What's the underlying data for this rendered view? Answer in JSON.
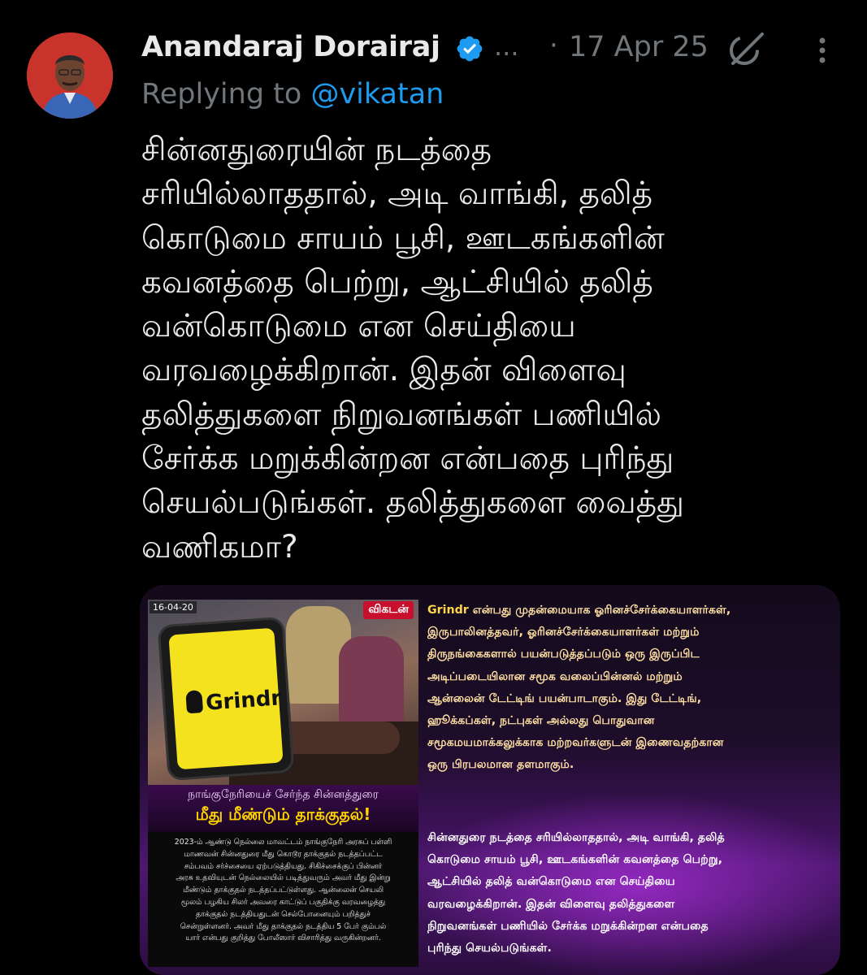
{
  "tweet": {
    "author_name": "Anandaraj Dorairaj",
    "more_name": "...",
    "dot": "·",
    "date": "17 Apr 25",
    "replying_prefix": "Replying to ",
    "replying_handle": "@vikatan",
    "body_lines": [
      "சின்னதுரையின்   நடத்தை",
      "சரியில்லாததால், அடி வாங்கி, தலித்",
      "கொடுமை சாயம் பூசி, ஊடகங்களின்",
      "கவனத்தை பெற்று, ஆட்சியில் தலித்",
      "வன்கொடுமை என செய்தியை",
      "வரவழைக்கிறான்.  இதன் விளைவு",
      "தலித்துகளை நிறுவனங்கள் பணியில்",
      "சேர்க்க மறுக்கின்றன என்பதை புரிந்து",
      "செயல்படுங்கள். தலித்துகளை வைத்து",
      "வணிகமா?"
    ]
  },
  "image_card": {
    "poster": {
      "date": "16-04-20",
      "logo": "விகடன்",
      "phone_app": "Grindr",
      "headline_1": "நாங்குநேரியைச் சேர்ந்த சின்னத்துரை",
      "headline_2": "மீது மீண்டும் தாக்குதல்!",
      "body_lines": [
        "2023-ம் ஆண்டு நெல்லை மாவட்டம் நாங்குநேரி அரசுப் பள்ளி",
        "மாணவன் சின்னதுரை மீது கொடூர தாக்குதல் நடத்தப்பட்ட",
        "சம்பவம் சர்ச்சையை ஏற்படுத்தியது. சிகிச்சைக்குப் பின்னர்",
        "அரசு உதவியுடன் நெல்லையில் படித்துவரும் அவர் மீது இன்று",
        "மீண்டும் தாக்குதல் நடத்தப்பட்டுள்ளது. ஆன்லைன் செயலி",
        "மூலம் பழகிய சிலர் அவரை காட்டுப் பகுதிக்கு வரவழைத்து",
        "தாக்குதல் நடத்தியதுடன் செல்போனையும் பறித்துச்",
        "சென்றுள்ளனர். அவர் மீது தாக்குதல் நடத்திய 5 பேர் கும்பல்",
        "யார் என்பது குறித்து போலீஸார் விசாரித்து வருகின்றனர்."
      ]
    },
    "info_keyword": "Grindr",
    "info_lines": [
      " என்பது முதன்மையாக ஓரினச்சேர்க்கையாளர்கள்,",
      "இருபாலினத்தவர், ஓரினச்சேர்க்கையாளர்கள் மற்றும்",
      "திருநங்கைகளால் பயன்படுத்தப்படும் ஒரு இருப்பிட",
      "அடிப்படையிலான சமூக வலைப்பின்னல் மற்றும்",
      "ஆன்லைன் டேட்டிங் பயன்பாடாகும். இது டேட்டிங்,",
      "ஹூக்கப்கள், நட்புகள் அல்லது பொதுவான",
      "சமூகமயமாக்கலுக்காக மற்றவர்களுடன் இணைவதற்கான",
      "ஒரு பிரபலமான தளமாகும்."
    ],
    "info2_lines": [
      "சின்னதுரை நடத்தை சரியில்லாததால், அடி வாங்கி, தலித்",
      "கொடுமை சாயம் பூசி, ஊடகங்களின் கவனத்தை பெற்று,",
      "ஆட்சியில் தலித் வன்கொடுமை என செய்தியை",
      "வரவழைக்கிறான்.  இதன் விளைவு தலித்துகளை",
      "நிறுவனங்கள் பணியில் சேர்க்க மறுக்கின்றன என்பதை",
      "புரிந்து செயல்படுங்கள்."
    ]
  },
  "colors": {
    "background": "#000000",
    "text": "#e7e9ea",
    "muted": "#71767b",
    "link": "#1d9bf0",
    "verified": "#1d9bf0"
  },
  "icons": [
    "avatar",
    "verified-badge-icon",
    "grok-icon",
    "more-icon"
  ]
}
